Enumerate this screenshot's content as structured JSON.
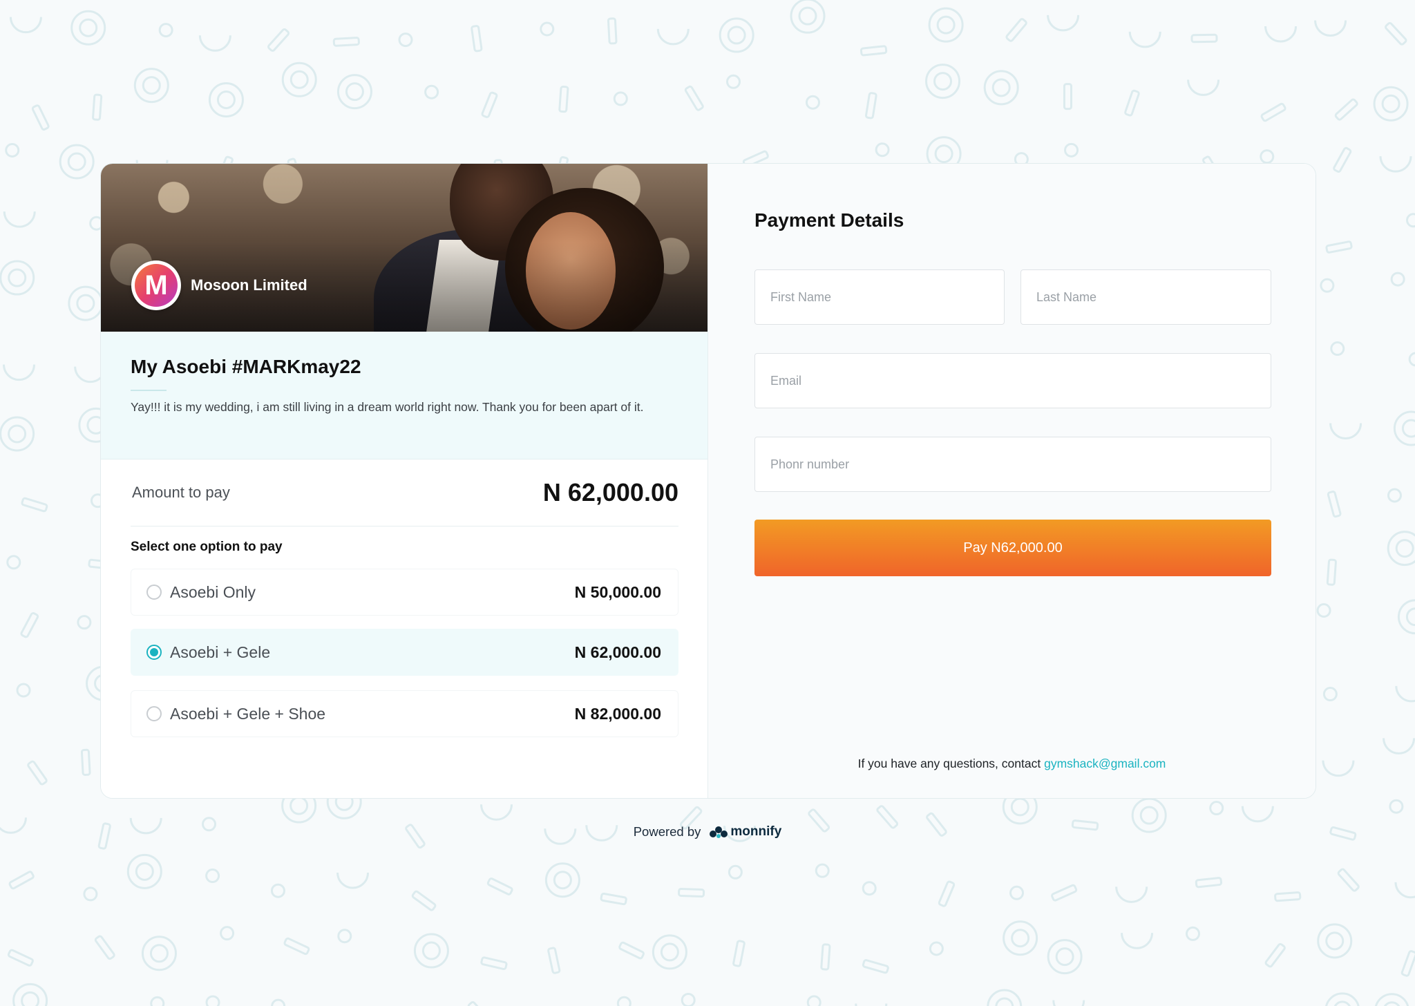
{
  "merchant": {
    "logo_letter": "M",
    "name": "Mosoon Limited"
  },
  "page": {
    "title": "My Asoebi #MARKmay22",
    "description": "Yay!!! it is my wedding, i am still living in a dream world right now. Thank you for been apart of it."
  },
  "amount": {
    "label": "Amount to pay",
    "value": "N 62,000.00"
  },
  "options": {
    "label": "Select one option to pay",
    "items": [
      {
        "name": "Asoebi Only",
        "price": "N 50,000.00",
        "selected": false
      },
      {
        "name": "Asoebi + Gele",
        "price": "N 62,000.00",
        "selected": true
      },
      {
        "name": "Asoebi + Gele + Shoe",
        "price": "N 82,000.00",
        "selected": false
      }
    ]
  },
  "payment": {
    "title": "Payment Details",
    "first_name_placeholder": "First Name",
    "last_name_placeholder": "Last Name",
    "email_placeholder": "Email",
    "phone_placeholder": "Phonr number",
    "pay_button": "Pay N62,000.00"
  },
  "contact": {
    "text": "If you have any questions, contact",
    "email": "gymshack@gmail.com"
  },
  "footer": {
    "powered_by": "Powered by",
    "brand": "monnify"
  },
  "colors": {
    "accent": "#1ab3c0",
    "pay_button_top": "#f29b24",
    "pay_button_bottom": "#f0642a",
    "intro_bg": "#effafb"
  },
  "icons": {
    "merchant_logo": "M-badge",
    "brand_logo": "monnify-mark"
  }
}
